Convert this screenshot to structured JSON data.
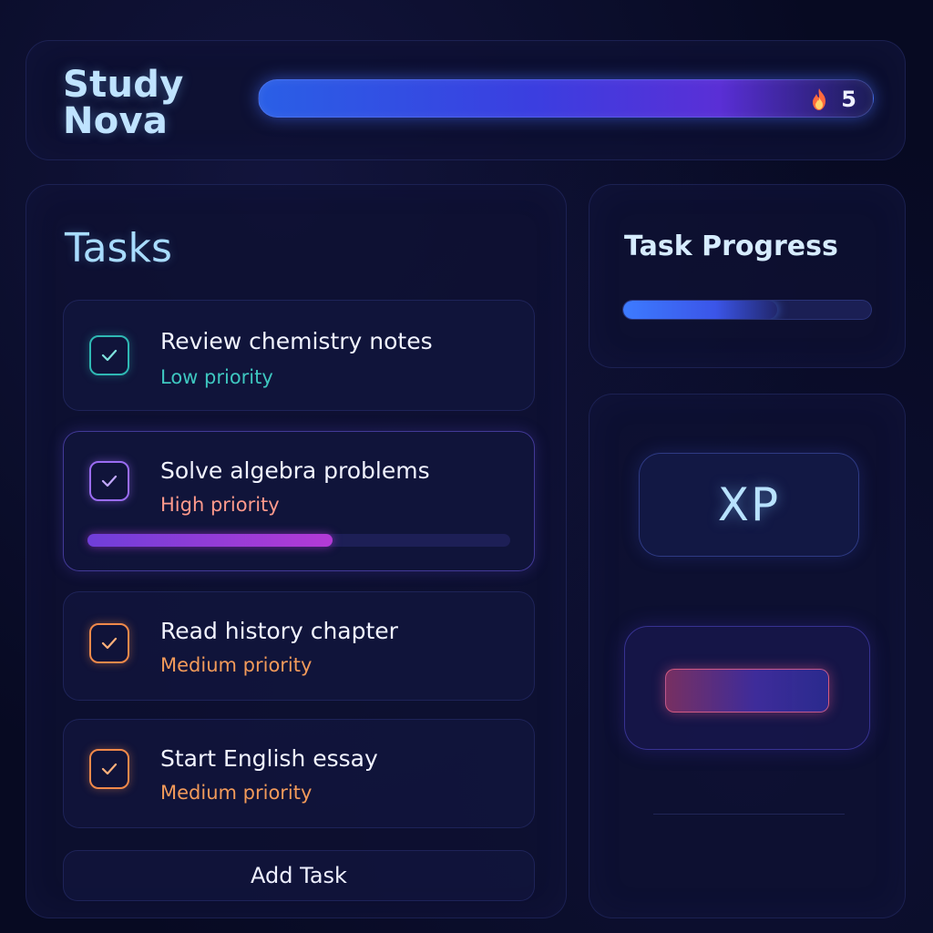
{
  "header": {
    "app_title": "Study Nova",
    "streak_count": "5",
    "streak_icon": "fire-icon"
  },
  "tasks": {
    "title": "Tasks",
    "items": [
      {
        "name": "Review chemistry notes",
        "priority": "Low priority",
        "color": "#3ec7c0",
        "checked": true
      },
      {
        "name": "Solve algebra problems",
        "priority": "High priority",
        "color": "#9a6cf2",
        "priority_color": "#ff9a8c",
        "checked": true,
        "progress": 0.58
      },
      {
        "name": "Read history chapter",
        "priority": "Medium priority",
        "color": "#f0894a",
        "checked": true
      },
      {
        "name": "Start English essay",
        "priority": "Medium priority",
        "color": "#f0894a",
        "checked": true
      }
    ],
    "add_label": "Add Task"
  },
  "progress": {
    "title": "Task Progress",
    "fraction": 0.62
  },
  "xp": {
    "label": "XP"
  },
  "colors": {
    "background": "#070a22",
    "accent_blue": "#3d7bff",
    "accent_purple": "#b43ad6"
  }
}
